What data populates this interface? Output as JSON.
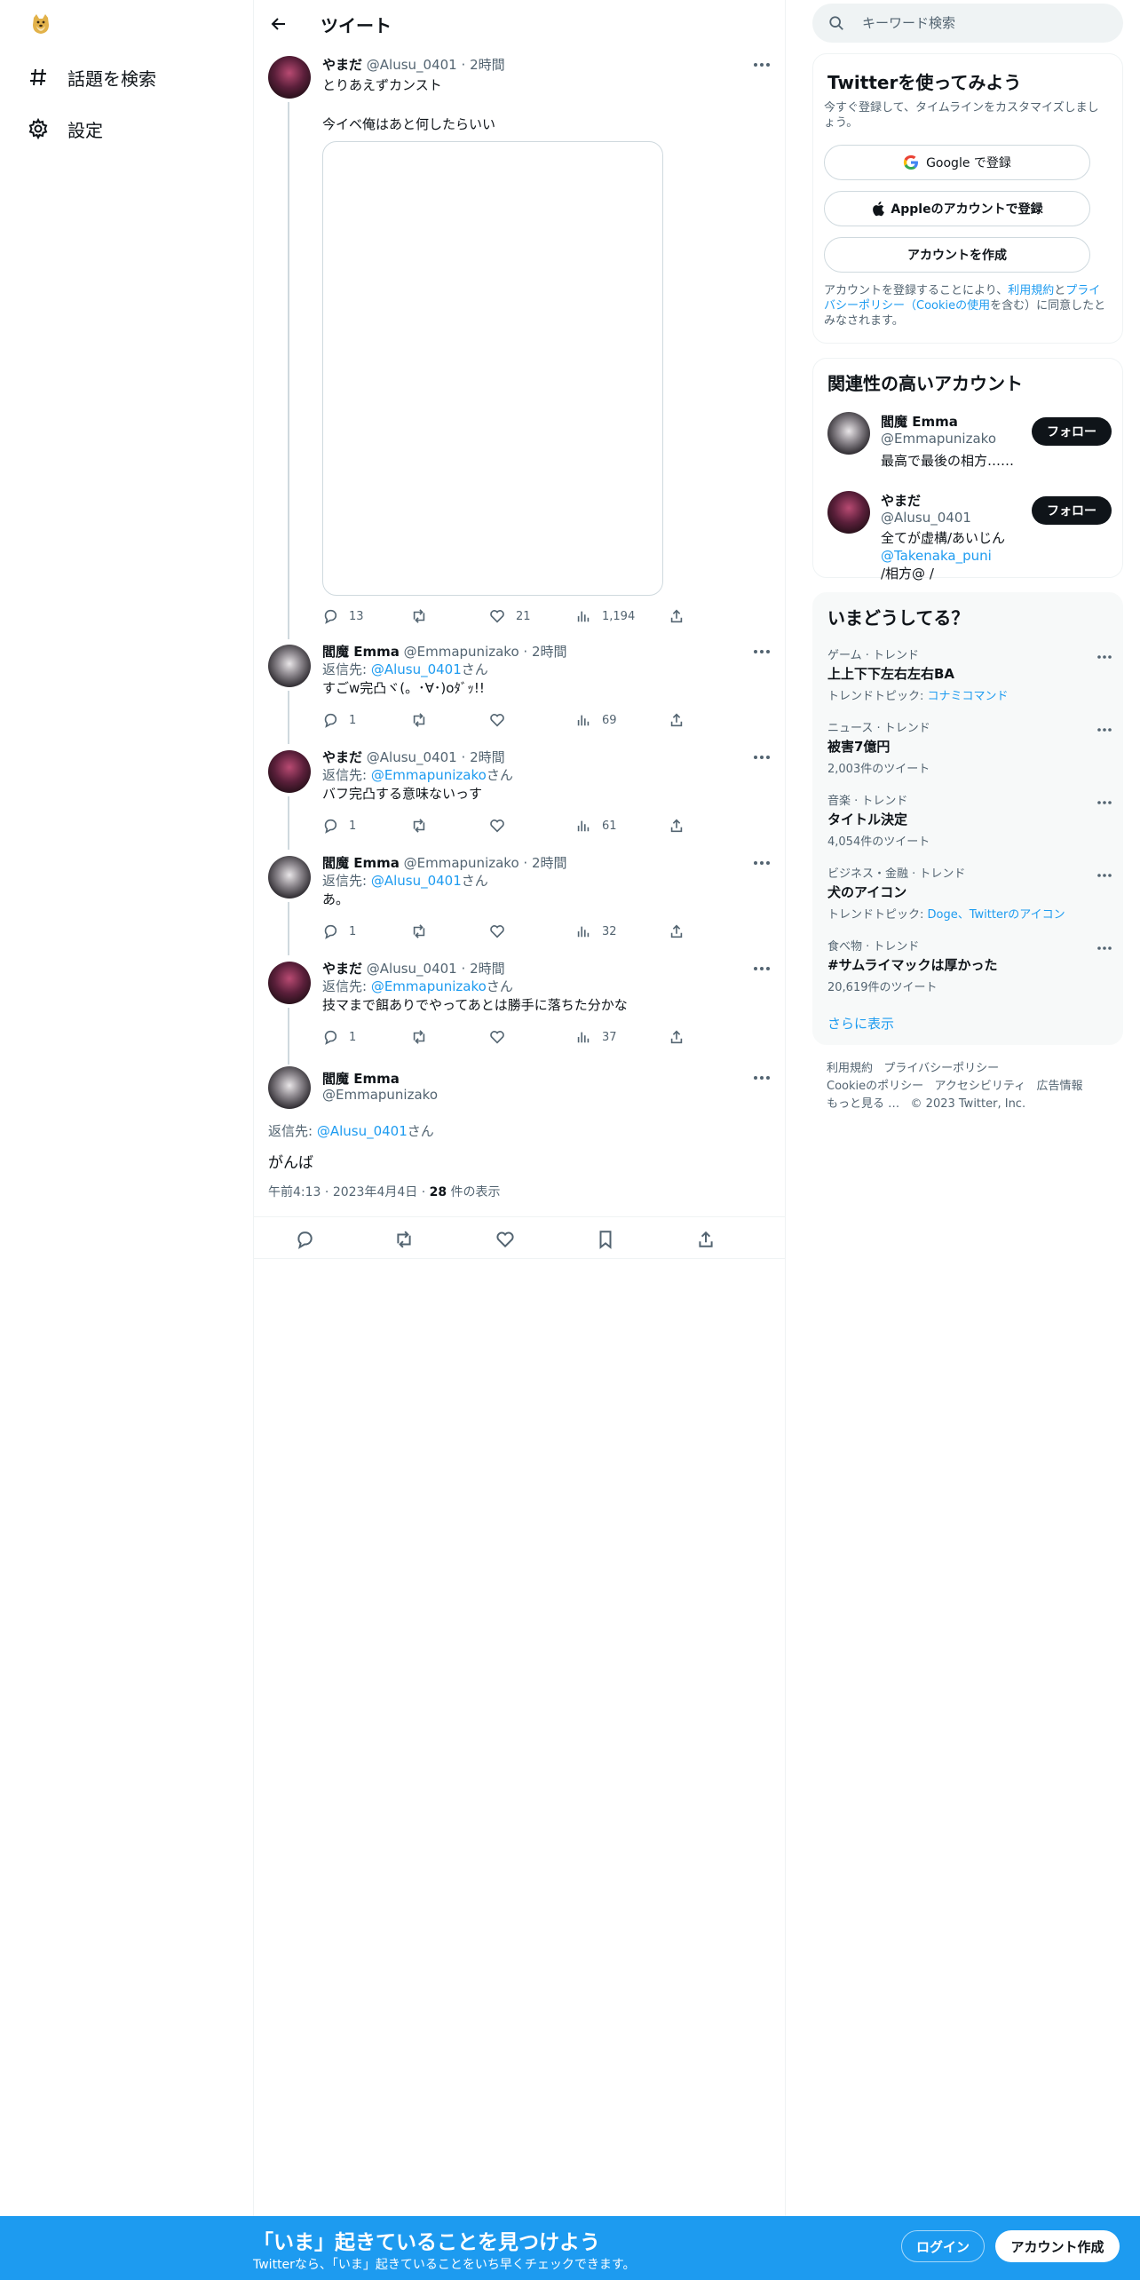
{
  "nav": {
    "items": [
      {
        "label": "話題を検索",
        "icon": "hashtag-icon"
      },
      {
        "label": "設定",
        "icon": "gear-icon"
      }
    ]
  },
  "header": {
    "title": "ツイート"
  },
  "thread": [
    {
      "name": "やまだ",
      "handle": "@Alusu_0401",
      "time": "2時間",
      "text": "とりあえずカンスト\n\n今イベ俺はあと何したらいい",
      "reply_to_prefix": "",
      "reply_to": "",
      "reply_to_suffix": "",
      "stats": {
        "reply": "13",
        "retweet": "",
        "like": "21",
        "views": "1,194"
      }
    },
    {
      "name": "閻魔 Emma",
      "handle": "@Emmapunizako",
      "time": "2時間",
      "reply_to_prefix": "返信先: ",
      "reply_to": "@Alusu_0401",
      "reply_to_suffix": "さん",
      "text": "すごw完凸ヾ(。･∀･)oﾀﾞｯ!!",
      "stats": {
        "reply": "1",
        "retweet": "",
        "like": "",
        "views": "69"
      }
    },
    {
      "name": "やまだ",
      "handle": "@Alusu_0401",
      "time": "2時間",
      "reply_to_prefix": "返信先: ",
      "reply_to": "@Emmapunizako",
      "reply_to_suffix": "さん",
      "text": "バフ完凸する意味ないっす",
      "stats": {
        "reply": "1",
        "retweet": "",
        "like": "",
        "views": "61"
      }
    },
    {
      "name": "閻魔 Emma",
      "handle": "@Emmapunizako",
      "time": "2時間",
      "reply_to_prefix": "返信先: ",
      "reply_to": "@Alusu_0401",
      "reply_to_suffix": "さん",
      "text": "あ。",
      "stats": {
        "reply": "1",
        "retweet": "",
        "like": "",
        "views": "32"
      }
    },
    {
      "name": "やまだ",
      "handle": "@Alusu_0401",
      "time": "2時間",
      "reply_to_prefix": "返信先: ",
      "reply_to": "@Emmapunizako",
      "reply_to_suffix": "さん",
      "text": "技マまで餌ありでやってあとは勝手に落ちた分かな",
      "stats": {
        "reply": "1",
        "retweet": "",
        "like": "",
        "views": "37"
      }
    }
  ],
  "focused": {
    "name": "閻魔 Emma",
    "handle": "@Emmapunizako",
    "reply_to_prefix": "返信先: ",
    "reply_to": "@Alusu_0401",
    "reply_to_suffix": "さん",
    "text": "がんば",
    "time": "午前4:13",
    "date": "2023年4月4日",
    "views_count": "28",
    "views_label": " 件の表示"
  },
  "sidebar": {
    "search_placeholder": "キーワード検索",
    "signup": {
      "title": "Twitterを使ってみよう",
      "subtitle": "今すぐ登録して、タイムラインをカスタマイズしましょう。",
      "google": "Google で登録",
      "apple": "Appleのアカウントで登録",
      "create": "アカウントを作成",
      "terms_pre": "アカウントを登録することにより、",
      "terms_link1": "利用規約",
      "terms_and": "と",
      "terms_link2": "プライバシーポリシー（Cookieの使用",
      "terms_post": "を含む）に同意したとみなされます。"
    },
    "related": {
      "title": "関連性の高いアカウント",
      "accounts": [
        {
          "name": "閻魔 Emma",
          "handle": "@Emmapunizako",
          "bio": "最高で最後の相方……",
          "follow": "フォロー"
        },
        {
          "name": "やまだ",
          "handle": "@Alusu_0401",
          "bio_pre": "全てが虚構/あいじん",
          "bio_link": "@Takenaka_puni",
          "bio_post": "/相方@ /",
          "follow": "フォロー"
        }
      ]
    },
    "trends": {
      "title": "いまどうしてる？",
      "items": [
        {
          "category": "ゲーム · トレンド",
          "title": "上上下下左右左右BA",
          "sub_pre": "トレンドトピック: ",
          "sub_link": "コナミコマンド"
        },
        {
          "category": "ニュース · トレンド",
          "title": "被害7億円",
          "sub_pre": "2,003件のツイート",
          "sub_link": ""
        },
        {
          "category": "音楽 · トレンド",
          "title": "タイトル決定",
          "sub_pre": "4,054件のツイート",
          "sub_link": ""
        },
        {
          "category": "ビジネス・金融 · トレンド",
          "title": "犬のアイコン",
          "sub_pre": "トレンドトピック: ",
          "sub_link": "Doge、Twitterのアイコン"
        },
        {
          "category": "食べ物 · トレンド",
          "title": "#サムライマックは厚かった",
          "sub_pre": "20,619件のツイート",
          "sub_link": ""
        }
      ],
      "show_more": "さらに表示"
    },
    "footer": {
      "l1a": "利用規約",
      "l1b": "プライバシーポリシー",
      "l2a": "Cookieのポリシー",
      "l2b": "アクセシビリティ",
      "l2c": "広告情報",
      "l3a": "もっと見る …",
      "l3b": "© 2023 Twitter, Inc."
    }
  },
  "bottombar": {
    "title": "「いま」起きていることを見つけよう",
    "subtitle": "Twitterなら、「いま」起きていることをいち早くチェックできます。",
    "login": "ログイン",
    "signup": "アカウント作成"
  },
  "colors": {
    "accent": "#1d9bf0",
    "text": "#0f1419",
    "muted": "#536471"
  }
}
